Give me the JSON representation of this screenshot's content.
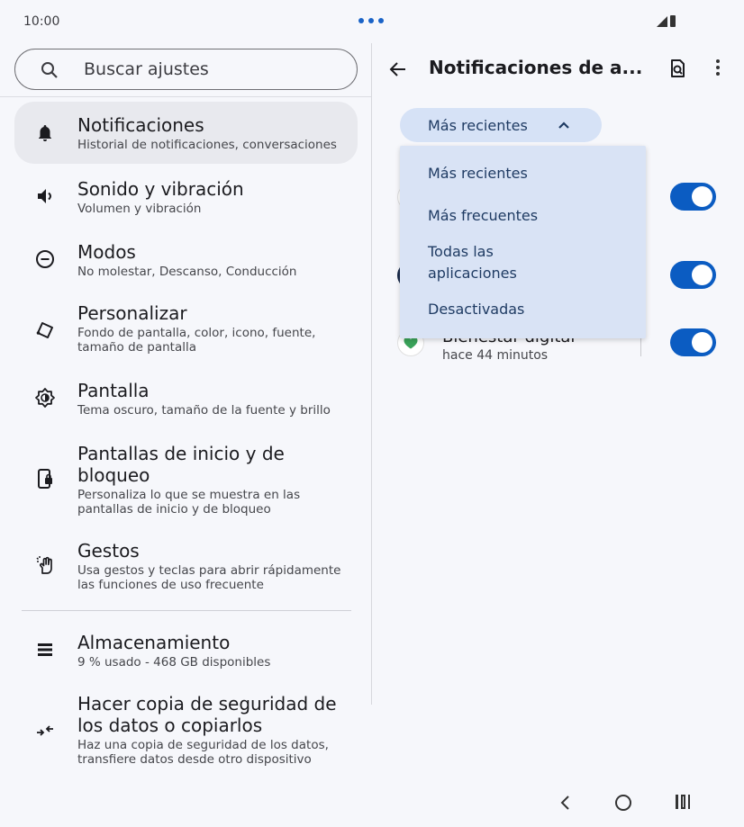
{
  "status": {
    "time": "10:00"
  },
  "search": {
    "placeholder": "Buscar ajustes"
  },
  "settings": {
    "items": [
      {
        "title": "Notificaciones",
        "subtitle": "Historial de notificaciones, conversaciones"
      },
      {
        "title": "Sonido y vibración",
        "subtitle": "Volumen y vibración"
      },
      {
        "title": "Modos",
        "subtitle": "No molestar, Descanso, Conducción"
      },
      {
        "title": "Personalizar",
        "subtitle": "Fondo de pantalla, color, icono, fuente, tamaño de pantalla"
      },
      {
        "title": "Pantalla",
        "subtitle": "Tema oscuro, tamaño de la fuente y brillo"
      },
      {
        "title": "Pantallas de inicio y de bloqueo",
        "subtitle": "Personaliza lo que se muestra en las pantallas de inicio y de bloqueo"
      },
      {
        "title": "Gestos",
        "subtitle": "Usa gestos y teclas para abrir rápidamente las funciones de uso frecuente"
      },
      {
        "title": "Almacenamiento",
        "subtitle": "9 % usado - 468 GB disponibles"
      },
      {
        "title": "Hacer copia de seguridad de los datos o copiarlos",
        "subtitle": "Haz una copia de seguridad de los datos, transfiere datos desde otro dispositivo"
      }
    ]
  },
  "detail": {
    "title": "Notificaciones de a...",
    "sort_selected": "Más recientes",
    "dropdown": [
      "Más recientes",
      "Más frecuentes",
      "Todas las aplicaciones",
      "Desactivadas"
    ],
    "apps": [
      {
        "name": "",
        "time": "",
        "enabled": true
      },
      {
        "name": "",
        "time": "",
        "enabled": true
      },
      {
        "name": "Bienestar digital",
        "time": "hace 44 minutos",
        "enabled": true
      }
    ]
  },
  "colors": {
    "accent": "#0b5cc2",
    "chip": "#d6e2f6",
    "dropdown": "#d9e3f5"
  }
}
